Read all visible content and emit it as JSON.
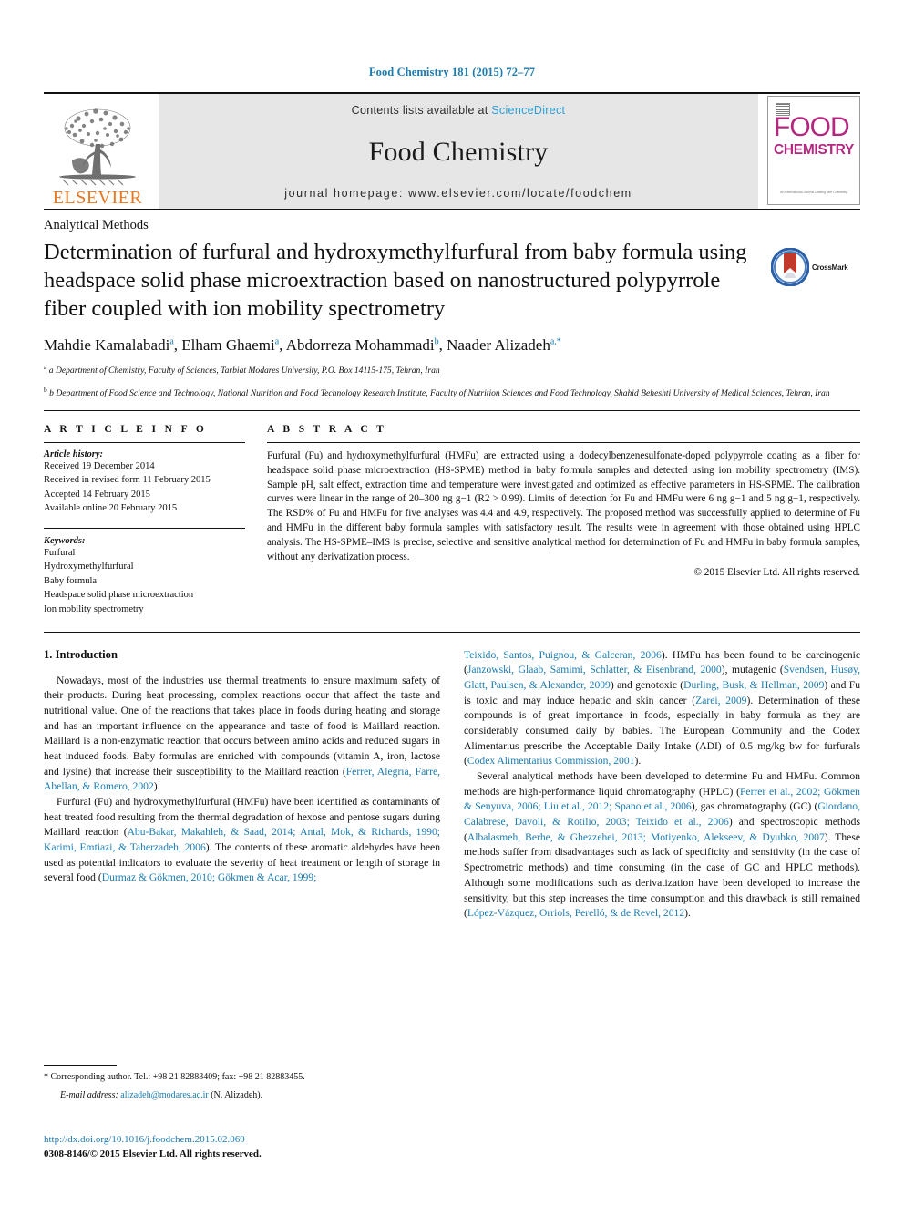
{
  "running_head": "Food Chemistry 181 (2015) 72–77",
  "masthead": {
    "publisher": "ELSEVIER",
    "contents_prefix": "Contents lists available at ",
    "contents_link": "ScienceDirect",
    "journal_title": "Food Chemistry",
    "homepage": "journal homepage: www.elsevier.com/locate/foodchem",
    "cover_word_top": "FOOD",
    "cover_word_bottom": "CHEMISTRY",
    "cover_footer": "An International Journal\nDealing with Chemistry"
  },
  "section_label": "Analytical Methods",
  "title": "Determination of furfural and hydroxymethylfurfural from baby formula using headspace solid phase microextraction based on nanostructured polypyrrole fiber coupled with ion mobility spectrometry",
  "crossmark_label": "CrossMark",
  "authors": "Mahdie Kamalabadi a, Elham Ghaemi a, Abdorreza Mohammadi b, Naader Alizadeh a,*",
  "affiliations": [
    "a Department of Chemistry, Faculty of Sciences, Tarbiat Modares University, P.O. Box 14115-175, Tehran, Iran",
    "b Department of Food Science and Technology, National Nutrition and Food Technology Research Institute, Faculty of Nutrition Sciences and Food Technology, Shahid Beheshti University of Medical Sciences, Tehran, Iran"
  ],
  "article_info": {
    "heading": "A R T I C L E   I N F O",
    "history_label": "Article history:",
    "history": [
      "Received 19 December 2014",
      "Received in revised form 11 February 2015",
      "Accepted 14 February 2015",
      "Available online 20 February 2015"
    ],
    "keywords_label": "Keywords:",
    "keywords": [
      "Furfural",
      "Hydroxymethylfurfural",
      "Baby formula",
      "Headspace solid phase microextraction",
      "Ion mobility spectrometry"
    ]
  },
  "abstract": {
    "heading": "A B S T R A C T",
    "text": "Furfural (Fu) and hydroxymethylfurfural (HMFu) are extracted using a dodecylbenzenesulfonate-doped polypyrrole coating as a fiber for headspace solid phase microextraction (HS-SPME) method in baby formula samples and detected using ion mobility spectrometry (IMS). Sample pH, salt effect, extraction time and temperature were investigated and optimized as effective parameters in HS-SPME. The calibration curves were linear in the range of 20–300 ng g−1 (R2 > 0.99). Limits of detection for Fu and HMFu were 6 ng g−1 and 5 ng g−1, respectively. The RSD% of Fu and HMFu for five analyses was 4.4 and 4.9, respectively. The proposed method was successfully applied to determine of Fu and HMFu in the different baby formula samples with satisfactory result. The results were in agreement with those obtained using HPLC analysis. The HS-SPME–IMS is precise, selective and sensitive analytical method for determination of Fu and HMFu in baby formula samples, without any derivatization process.",
    "copyright": "© 2015 Elsevier Ltd. All rights reserved."
  },
  "intro": {
    "heading": "1. Introduction",
    "left_paragraphs": [
      "Nowadays, most of the industries use thermal treatments to ensure maximum safety of their products. During heat processing, complex reactions occur that affect the taste and nutritional value. One of the reactions that takes place in foods during heating and storage and has an important influence on the appearance and taste of food is Maillard reaction. Maillard is a non-enzymatic reaction that occurs between amino acids and reduced sugars in heat induced foods. Baby formulas are enriched with compounds (vitamin A, iron, lactose and lysine) that increase their susceptibility to the Maillard reaction (Ferrer, Alegrıa, Farre, Abellan, & Romero, 2002).",
      "Furfural (Fu) and hydroxymethylfurfural (HMFu) have been identified as contaminants of heat treated food resulting from the thermal degradation of hexose and pentose sugars during Maillard reaction (Abu-Bakar, Makahleh, & Saad, 2014; Antal, Mok, & Richards, 1990; Karimi, Emtiazi, & Taherzadeh, 2006). The contents of these aromatic aldehydes have been used as potential indicators to evaluate the severity of heat treatment or length of storage in several food (Durmaz & Gökmen, 2010; Gökmen & Acar, 1999;"
    ],
    "right_paragraphs": [
      "Teixido, Santos, Puignou, & Galceran, 2006). HMFu has been found to be carcinogenic (Janzowski, Glaab, Samimi, Schlatter, & Eisenbrand, 2000), mutagenic (Svendsen, Husøy, Glatt, Paulsen, & Alexander, 2009) and genotoxic (Durling, Busk, & Hellman, 2009) and Fu is toxic and may induce hepatic and skin cancer (Zarei, 2009). Determination of these compounds is of great importance in foods, especially in baby formula as they are considerably consumed daily by babies. The European Community and the Codex Alimentarius prescribe the Acceptable Daily Intake (ADI) of 0.5 mg/kg bw for furfurals (Codex Alimentarius Commission, 2001).",
      "Several analytical methods have been developed to determine Fu and HMFu. Common methods are high-performance liquid chromatography (HPLC) (Ferrer et al., 2002; Gökmen & Senyuva, 2006; Liu et al., 2012; Spano et al., 2006), gas chromatography (GC) (Giordano, Calabrese, Davoli, & Rotilio, 2003; Teixido et al., 2006) and spectroscopic methods (Albalasmeh, Berhe, & Ghezzehei, 2013; Motiyenko, Alekseev, & Dyubko, 2007). These methods suffer from disadvantages such as lack of specificity and sensitivity (in the case of Spectrometric methods) and time consuming (in the case of GC and HPLC methods). Although some modifications such as derivatization have been developed to increase the sensitivity, but this step increases the time consumption and this drawback is still remained (López-Vázquez, Orriols, Perelló, & de Revel, 2012)."
    ]
  },
  "footnote": {
    "corresponding": "* Corresponding author. Tel.: +98 21 82883409; fax: +98 21 82883455.",
    "email_label": "E-mail address:",
    "email": "alizadeh@modares.ac.ir",
    "email_suffix": "(N. Alizadeh)."
  },
  "doi": "http://dx.doi.org/10.1016/j.foodchem.2015.02.069",
  "issn_line": "0308-8146/© 2015 Elsevier Ltd. All rights reserved.",
  "colors": {
    "link": "#1a7bb0",
    "sciencedirect": "#2a9fd6",
    "elsevier_orange": "#E87722",
    "cover_magenta": "#b3277f",
    "band_gray": "#e6e6e6"
  }
}
